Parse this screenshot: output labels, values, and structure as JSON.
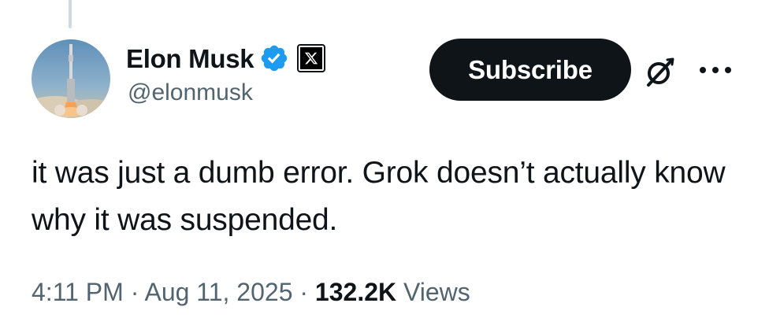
{
  "author": {
    "display_name": "Elon Musk",
    "handle": "@elonmusk",
    "avatar_icon": "rocket-launch-avatar",
    "verified_color": "#1d9bf0"
  },
  "header": {
    "subscribe_label": "Subscribe",
    "grok_icon": "grok-icon",
    "more_icon": "more-dots-icon"
  },
  "tweet": {
    "text": "it was just a dumb error. Grok doesn’t actually know why it was suspended."
  },
  "meta": {
    "time": "4:11 PM",
    "separator": "·",
    "date": "Aug 11, 2025",
    "views_count": "132.2K",
    "views_label": "Views"
  },
  "colors": {
    "text_primary": "#0f1419",
    "text_secondary": "#536471",
    "button_bg": "#0f1419",
    "thread_line": "#cfd9de"
  }
}
